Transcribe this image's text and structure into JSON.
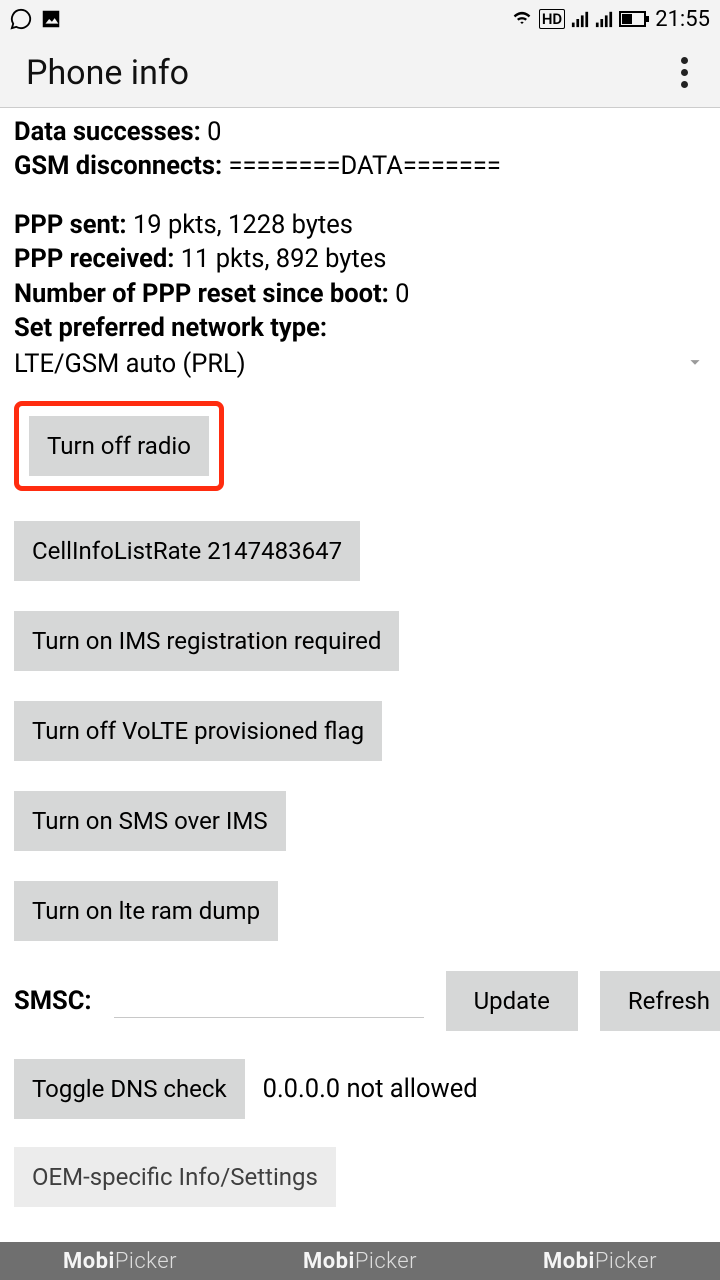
{
  "status": {
    "time": "21:55",
    "hd": "HD"
  },
  "app": {
    "title": "Phone info"
  },
  "info": {
    "data_successes_label": "Data successes:",
    "data_successes_value": "0",
    "gsm_disconnects_label": "GSM disconnects:",
    "gsm_disconnects_value": "========DATA=======",
    "ppp_sent_label": "PPP sent:",
    "ppp_sent_value": "19 pkts, 1228 bytes",
    "ppp_received_label": "PPP received:",
    "ppp_received_value": "11 pkts, 892 bytes",
    "ppp_reset_label": "Number of PPP reset since boot:",
    "ppp_reset_value": "0",
    "preferred_type_label": "Set preferred network type:",
    "preferred_type_value": "LTE/GSM auto (PRL)"
  },
  "buttons": {
    "turn_off_radio": "Turn off radio",
    "cell_info": "CellInfoListRate 2147483647",
    "ims_registration": "Turn on IMS registration required",
    "volte_flag": "Turn off VoLTE provisioned flag",
    "sms_ims": "Turn on SMS over IMS",
    "lte_ram_dump": "Turn on lte ram dump",
    "update": "Update",
    "refresh": "Refresh",
    "toggle_dns": "Toggle DNS check",
    "oem_info": "OEM-specific Info/Settings"
  },
  "smsc": {
    "label": "SMSC:",
    "value": ""
  },
  "dns": {
    "status": "0.0.0.0 not allowed"
  },
  "watermark": {
    "brand1": "Mobi",
    "brand2": "Picker"
  }
}
